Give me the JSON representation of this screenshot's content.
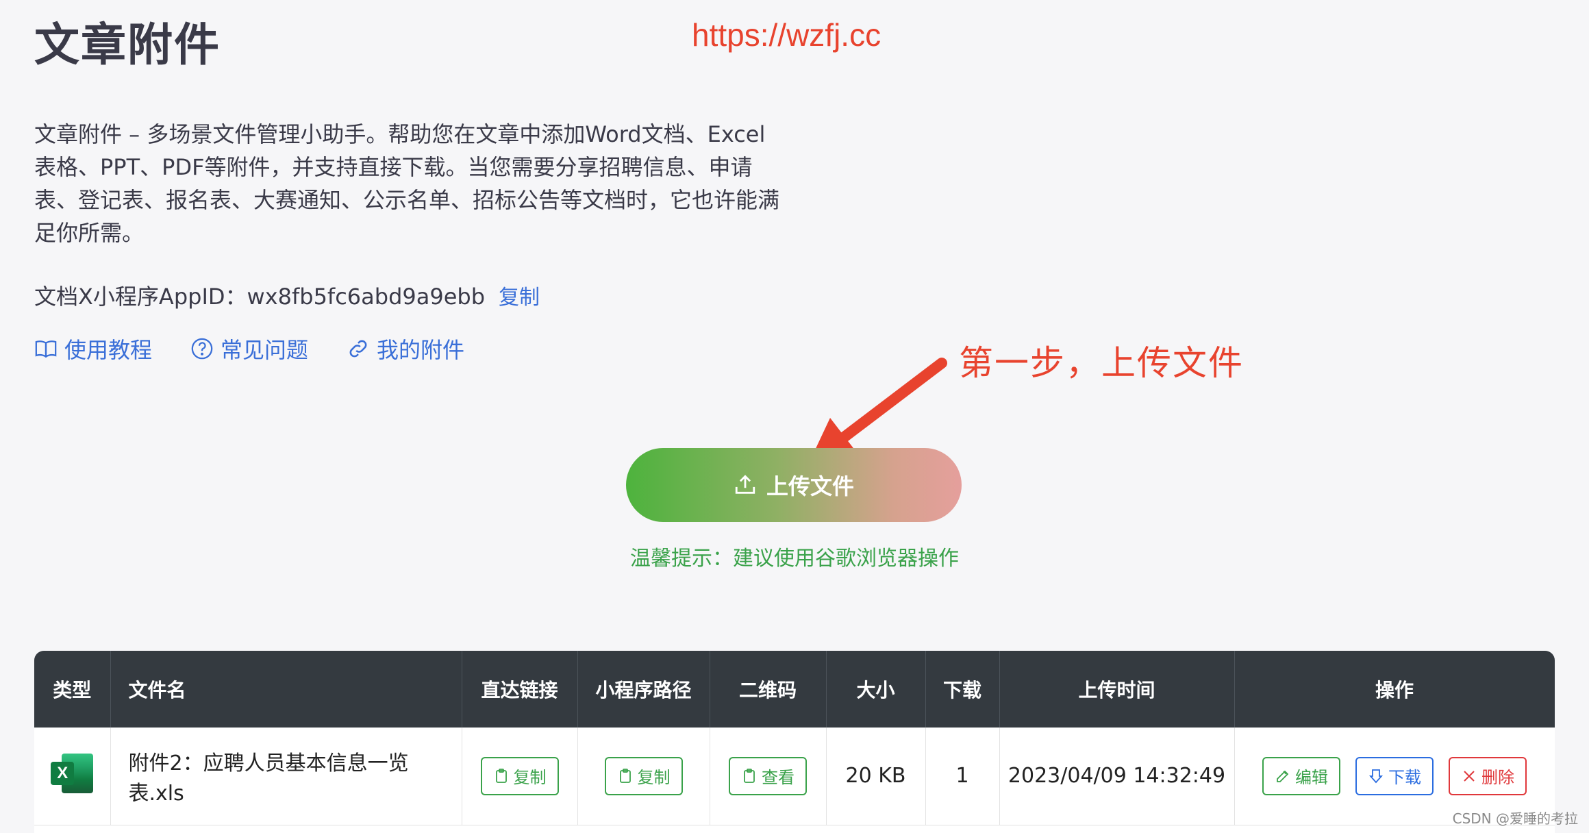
{
  "page": {
    "title": "文章附件",
    "url_annotation": "https://wzfj.cc",
    "description": "文章附件 – 多场景文件管理小助手。帮助您在文章中添加Word文档、Excel表格、PPT、PDF等附件，并支持直接下载。当您需要分享招聘信息、申请表、登记表、报名表、大赛通知、公示名单、招标公告等文档时，它也许能满足你所需。",
    "appid_label": "文档X小程序AppID：wx8fb5fc6abd9a9ebb",
    "appid_copy": "复制"
  },
  "nav": {
    "links": [
      {
        "label": "使用教程",
        "icon": "book-icon"
      },
      {
        "label": "常见问题",
        "icon": "question-circle-icon"
      },
      {
        "label": "我的附件",
        "icon": "link-icon"
      }
    ]
  },
  "annotation": {
    "step_text": "第一步，上传文件",
    "color": "#e8432e"
  },
  "upload": {
    "button_label": "上传文件",
    "tip": "温馨提示：建议使用谷歌浏览器操作"
  },
  "table": {
    "headers": [
      "类型",
      "文件名",
      "直达链接",
      "小程序路径",
      "二维码",
      "大小",
      "下载",
      "上传时间",
      "操作"
    ],
    "rows": [
      {
        "type_icon": "excel-icon",
        "type_badge": "X",
        "filename": "附件2：应聘人员基本信息一览表.xls",
        "direct_link": "复制",
        "mini_path": "复制",
        "qrcode": "查看",
        "size": "20 KB",
        "downloads": "1",
        "upload_time": "2023/04/09 14:32:49",
        "edit": "编辑",
        "download": "下载",
        "delete": "删除"
      }
    ]
  },
  "watermark": "CSDN @爱睡的考拉",
  "colors": {
    "accent_green": "#3aa24a",
    "accent_blue": "#2b6de0",
    "danger_red": "#e0383b",
    "header_dark": "#343a40"
  }
}
